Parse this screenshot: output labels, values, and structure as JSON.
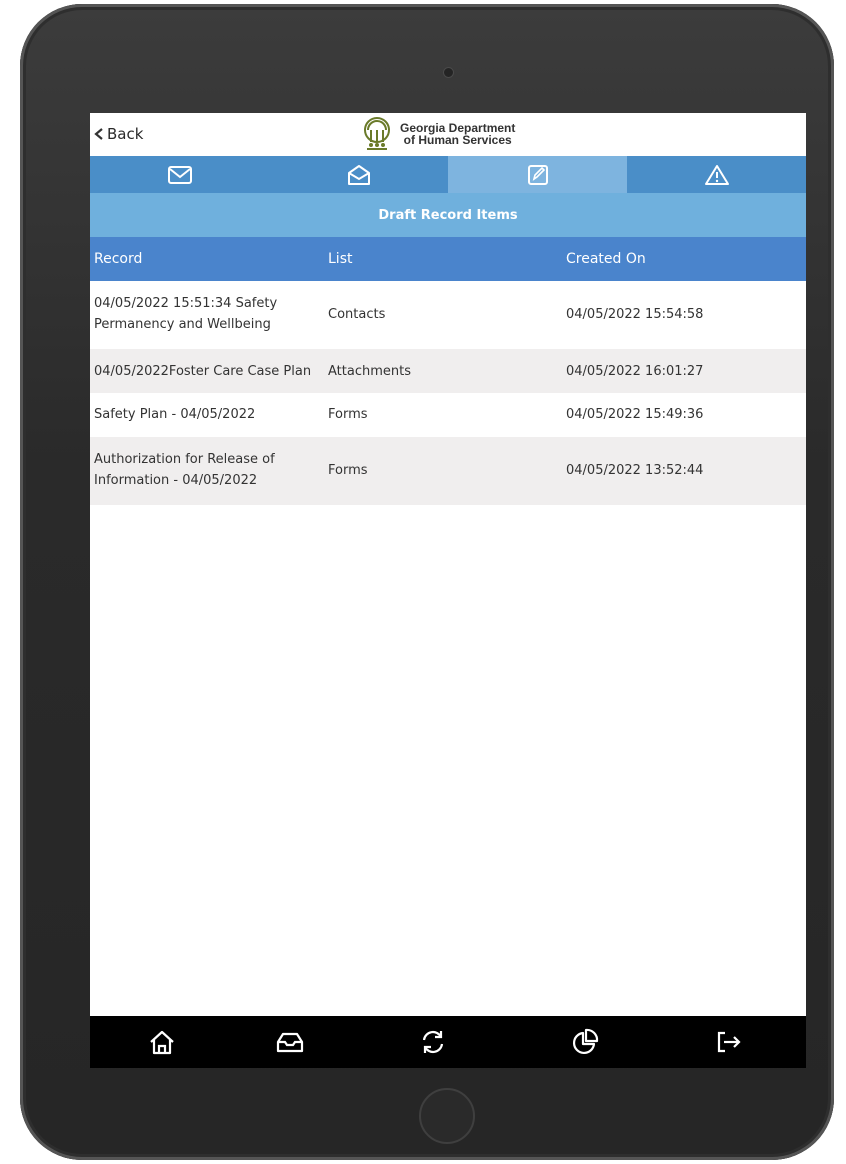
{
  "header": {
    "back_label": "Back",
    "logo_line1": "Georgia Department",
    "logo_line2": "of Human Services"
  },
  "tabs": [
    {
      "icon": "mail-icon",
      "active": false
    },
    {
      "icon": "open-mail-icon",
      "active": false
    },
    {
      "icon": "edit-icon",
      "active": true
    },
    {
      "icon": "warning-icon",
      "active": false
    }
  ],
  "page_title": "Draft Record Items",
  "table": {
    "columns": [
      "Record",
      "List",
      "Created On"
    ],
    "rows": [
      {
        "record": "04/05/2022 15:51:34 Safety Permanency and Wellbeing",
        "record_line1": "04/05/2022 15:51:34 Safety",
        "record_line2": "Permanency and Wellbeing",
        "list": "Contacts",
        "created_on": "04/05/2022 15:54:58"
      },
      {
        "record": "04/05/2022Foster Care Case Plan",
        "list": "Attachments",
        "created_on": "04/05/2022 16:01:27"
      },
      {
        "record": "Safety Plan - 04/05/2022",
        "list": "Forms",
        "created_on": "04/05/2022 15:49:36"
      },
      {
        "record": "Authorization for Release of Information - 04/05/2022",
        "record_line1": "Authorization for Release of",
        "record_line2": "Information - 04/05/2022",
        "list": "Forms",
        "created_on": "04/05/2022 13:52:44"
      }
    ]
  },
  "bottom_nav": [
    "home-icon",
    "inbox-icon",
    "sync-icon",
    "chart-icon",
    "logout-icon"
  ],
  "colors": {
    "tab_bar": "#4a8ec8",
    "tab_active": "#7eb4df",
    "title_bar": "#6fb0dd",
    "table_header": "#4a84cc",
    "row_alt": "#f0eeee",
    "bottom_bar": "#000000"
  }
}
